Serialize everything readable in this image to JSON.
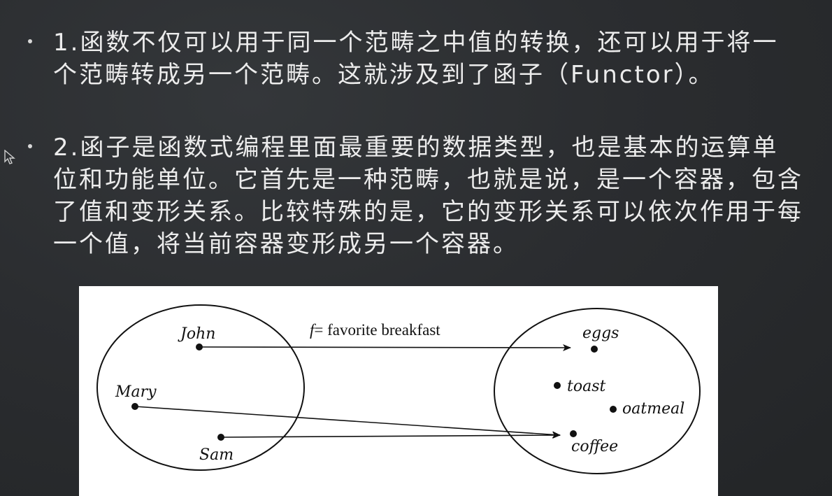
{
  "bullets": [
    {
      "text": "1.函数不仅可以用于同一个范畴之中值的转换，还可以用于将一个范畴转成另一个范畴。这就涉及到了函子（Functor）。"
    },
    {
      "text": "2.函子是函数式编程里面最重要的数据类型，也是基本的运算单位和功能单位。它首先是一种范畴，也就是说，是一个容器，包含了值和变形关系。比较特殊的是，它的变形关系可以依次作用于每一个值，将当前容器变形成另一个容器。"
    }
  ],
  "diagram": {
    "function_label_f": "f",
    "function_label_rest": "= favorite breakfast",
    "domain": [
      "John",
      "Mary",
      "Sam"
    ],
    "codomain": [
      "eggs",
      "toast",
      "oatmeal",
      "coffee"
    ],
    "mappings": [
      {
        "from": "John",
        "to": "eggs"
      },
      {
        "from": "Mary",
        "to": "coffee"
      },
      {
        "from": "Sam",
        "to": "coffee"
      }
    ]
  }
}
